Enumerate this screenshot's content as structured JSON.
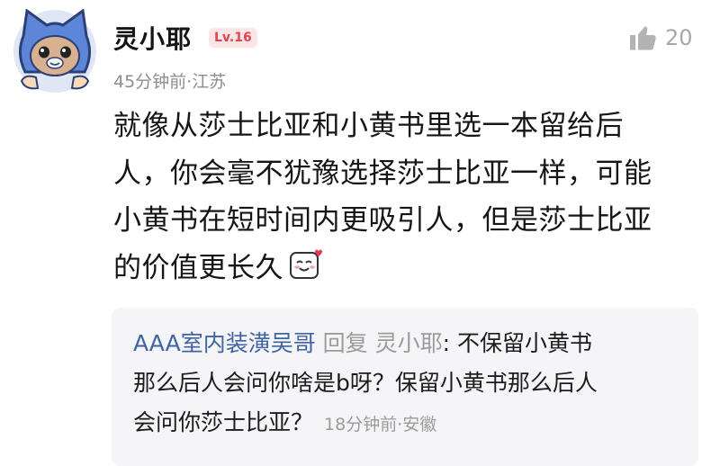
{
  "comment": {
    "username": "灵小耶",
    "level": "Lv.16",
    "meta": "45分钟前·江苏",
    "like_count": "20",
    "content_lines": [
      "就像从莎士比亚和小黄书里选一本留给后",
      "人，你会毫不犹豫选择莎士比亚一样，可能",
      "小黄书在短时间内更吸引人，但是莎士比亚",
      "的价值更长久"
    ],
    "emoji_name": "smile-blush-emoji"
  },
  "reply": {
    "author": "AAA室内装潢吴哥",
    "action": "回复",
    "target": "灵小耶",
    "separator": ":",
    "lines": [
      " 不保留小黄书",
      "那么后人会问你啥是b呀？保留小黄书那么后人",
      "会问你莎士比亚？"
    ],
    "time": "18分钟前·安徽"
  },
  "colors": {
    "author_blue": "#3f63a4",
    "level_red": "#e0454e",
    "reply_bg": "#f5f5f7"
  }
}
